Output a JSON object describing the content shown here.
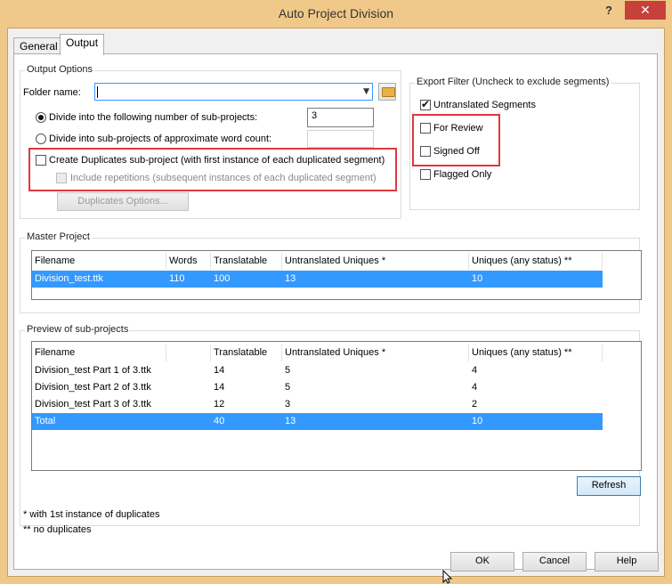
{
  "window": {
    "title": "Auto Project Division",
    "help_glyph": "?",
    "close_glyph": "✕"
  },
  "tabs": [
    "General",
    "Output"
  ],
  "output_options": {
    "title": "Output Options",
    "folder_label": "Folder name:",
    "folder_value": "",
    "radio_subprojects_label": "Divide into the following number of sub-projects:",
    "radio_subprojects_value": "3",
    "radio_wordcount_label": "Divide into sub-projects of approximate word count:",
    "radio_wordcount_value": "",
    "create_duplicates_label": "Create Duplicates sub-project (with first instance of each duplicated segment)",
    "include_repetitions_label": "Include repetitions (subsequent instances of each duplicated segment)",
    "duplicates_options_label": "Duplicates Options..."
  },
  "export_filter": {
    "title": "Export Filter (Uncheck to exclude segments)",
    "items": [
      {
        "label": "Untranslated Segments",
        "checked": true
      },
      {
        "label": "For Review",
        "checked": false
      },
      {
        "label": "Signed Off",
        "checked": false
      },
      {
        "label": "Flagged Only",
        "checked": false
      }
    ]
  },
  "master_project": {
    "title": "Master Project",
    "headers": [
      "Filename",
      "Words",
      "Translatable",
      "Untranslated Uniques *",
      "Uniques (any status) **"
    ],
    "rows": [
      [
        "Division_test.ttk",
        "110",
        "100",
        "13",
        "10"
      ]
    ]
  },
  "preview": {
    "title": "Preview of sub-projects",
    "headers": [
      "Filename",
      "",
      "Translatable",
      "Untranslated Uniques *",
      "Uniques (any status) **"
    ],
    "rows": [
      [
        "Division_test Part 1 of 3.ttk",
        "",
        "14",
        "5",
        "4"
      ],
      [
        "Division_test Part 2 of 3.ttk",
        "",
        "14",
        "5",
        "4"
      ],
      [
        "Division_test Part 3 of 3.ttk",
        "",
        "12",
        "3",
        "2"
      ],
      [
        "Total",
        "",
        "40",
        "13",
        "10"
      ]
    ],
    "refresh_label": "Refresh"
  },
  "footnotes": [
    "* with 1st instance of duplicates",
    "** no duplicates"
  ],
  "buttons": {
    "ok": "OK",
    "cancel": "Cancel",
    "help": "Help"
  }
}
